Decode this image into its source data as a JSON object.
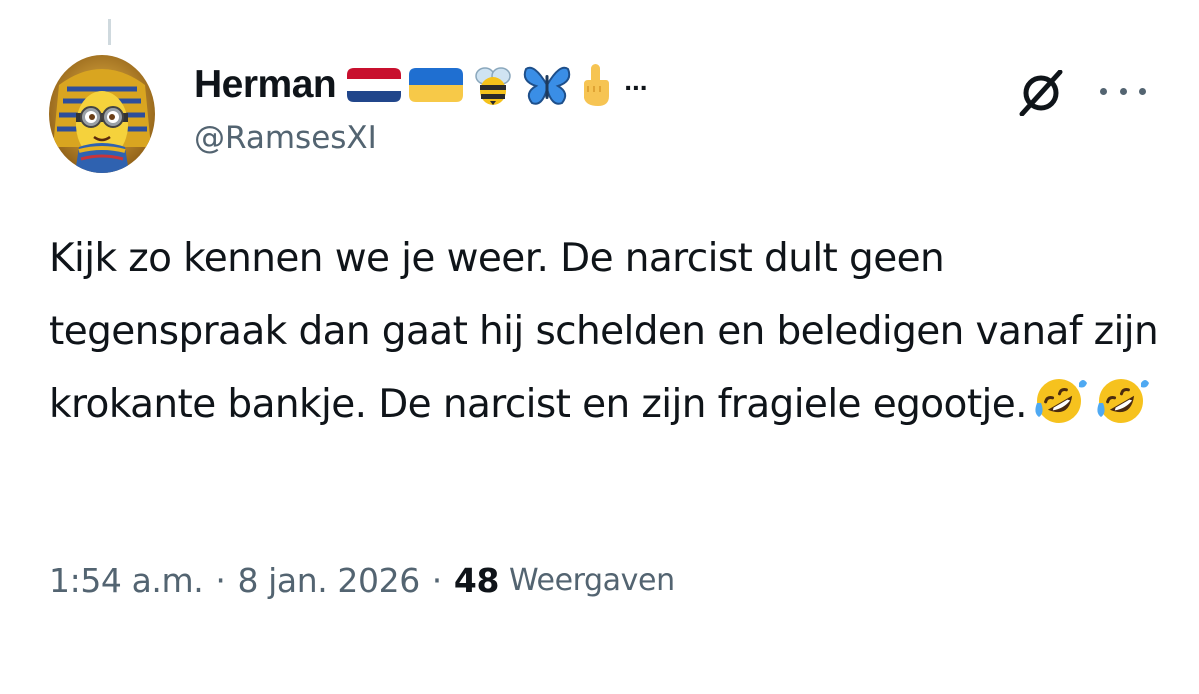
{
  "author": {
    "display_name": "Herman",
    "handle": "@RamsesXI",
    "avatar_icon": "pharaoh-minion-avatar",
    "badges": [
      "netherlands-flag-icon",
      "ukraine-flag-icon",
      "bee-icon",
      "butterfly-icon",
      "middle-finger-icon"
    ],
    "badges_more": "..."
  },
  "actions": {
    "grok_icon": "grok-icon",
    "more_icon": "more-options-icon"
  },
  "tweet": {
    "text": "Kijk zo kennen we je weer. De narcist dult geen tegenspraak dan gaat hij schelden en beledigen vanaf zijn krokante bankje. De narcist en zijn fragiele egootje.",
    "emojis": [
      "rolling-on-floor-laughing-icon",
      "rolling-on-floor-laughing-icon"
    ]
  },
  "meta": {
    "time": "1:54 a.m.",
    "separator": "·",
    "date": "8 jan. 2026",
    "views_count": "48",
    "views_label": "Weergaven"
  },
  "colors": {
    "text_primary": "#0f1419",
    "text_secondary": "#536471",
    "thread_line": "#cfd9de"
  }
}
